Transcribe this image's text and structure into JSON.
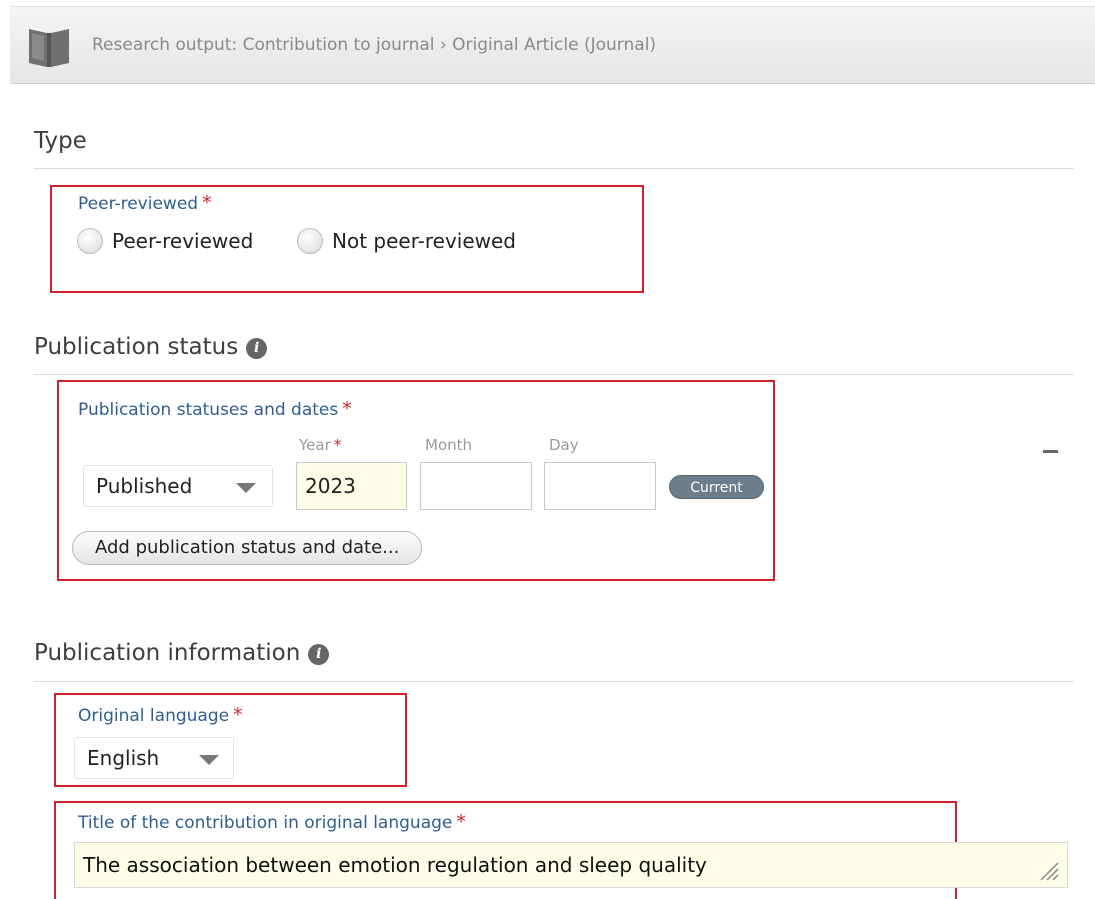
{
  "header": {
    "icon": "book-icon",
    "breadcrumb": "Research output: Contribution to journal › Original Article (Journal)"
  },
  "sections": {
    "type": {
      "title": "Type",
      "peer_reviewed": {
        "label": "Peer-reviewed",
        "required_mark": "*",
        "options": [
          "Peer-reviewed",
          "Not peer-reviewed"
        ]
      }
    },
    "publication_status": {
      "title": "Publication status",
      "info_icon": "i",
      "statuses": {
        "label": "Publication statuses and dates",
        "required_mark": "*",
        "year_label": "Year",
        "month_label": "Month",
        "day_label": "Day",
        "status_value": "Published",
        "year_value": "2023",
        "month_value": "",
        "day_value": "",
        "current_badge": "Current",
        "add_button": "Add publication status and date..."
      }
    },
    "publication_information": {
      "title": "Publication information",
      "info_icon": "i",
      "language": {
        "label": "Original language",
        "required_mark": "*",
        "value": "English"
      },
      "title_field": {
        "label": "Title of the contribution in original language",
        "required_mark": "*",
        "value": "The association between emotion regulation and sleep quality"
      }
    }
  },
  "colors": {
    "required": "#d0222a",
    "field_label": "#2f5e8e",
    "highlight_box": "#d0222a",
    "filled_input": "#fdfde8"
  }
}
